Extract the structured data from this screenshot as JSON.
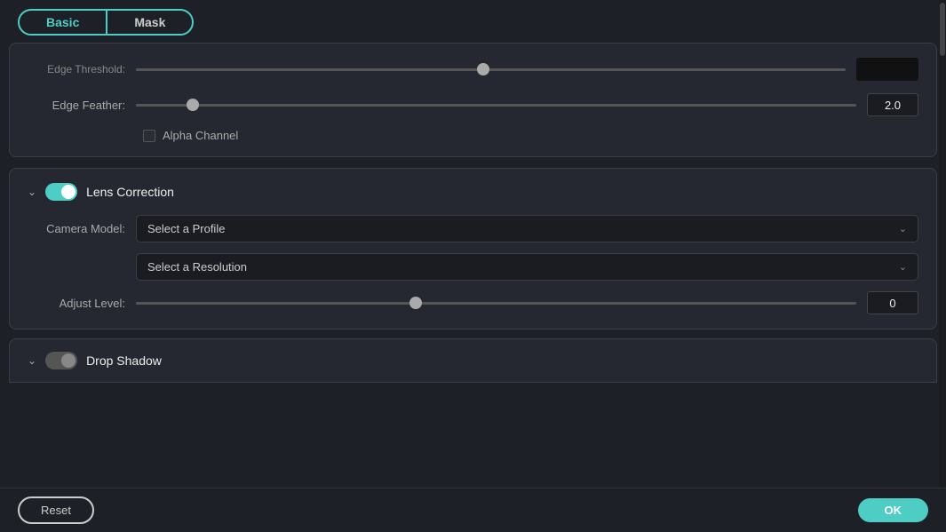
{
  "tabs": {
    "basic_label": "Basic",
    "mask_label": "Mask"
  },
  "edge_threshold": {
    "label": "Edge Threshold:",
    "value": ""
  },
  "edge_feather": {
    "label": "Edge Feather:",
    "value": "2.0",
    "slider_percent": 8
  },
  "alpha_channel": {
    "label": "Alpha Channel"
  },
  "lens_correction": {
    "title": "Lens Correction",
    "camera_model_label": "Camera Model:",
    "camera_model_placeholder": "Select a Profile",
    "resolution_placeholder": "Select a Resolution",
    "adjust_level_label": "Adjust Level:",
    "adjust_level_value": "0",
    "adjust_slider_percent": 40
  },
  "drop_shadow": {
    "title": "Drop Shadow"
  },
  "buttons": {
    "reset_label": "Reset",
    "ok_label": "OK"
  }
}
